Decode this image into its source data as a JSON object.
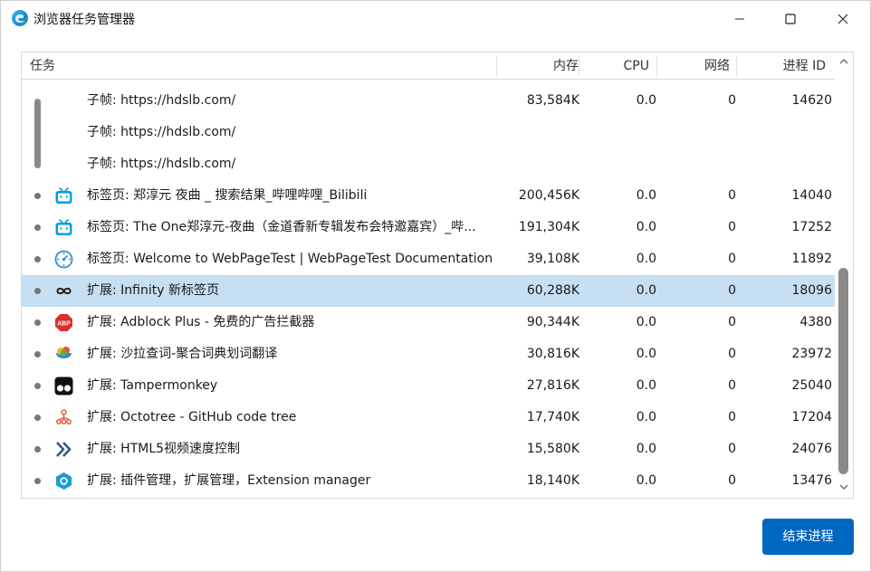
{
  "window": {
    "title": "浏览器任务管理器",
    "icons": {
      "app": "edge-logo-icon",
      "minimize": "minimize-icon",
      "maximize": "maximize-icon",
      "close": "close-icon"
    }
  },
  "columns": {
    "task": "任务",
    "memory": "内存",
    "cpu": "CPU",
    "network": "网络",
    "pid": "进程 ID"
  },
  "rows": [
    {
      "name": "子帧: https://hdslb.com/",
      "memory": "83,584K",
      "cpu": "0.0",
      "network": "0",
      "pid": "14620",
      "icon": "",
      "bullet": false,
      "selected": false
    },
    {
      "name": "子帧: https://hdslb.com/",
      "memory": "",
      "cpu": "",
      "network": "",
      "pid": "",
      "icon": "",
      "bullet": false,
      "selected": false
    },
    {
      "name": "子帧: https://hdslb.com/",
      "memory": "",
      "cpu": "",
      "network": "",
      "pid": "",
      "icon": "",
      "bullet": false,
      "selected": false
    },
    {
      "name": "标签页: 郑淳元 夜曲 _ 搜索结果_哔哩哔哩_Bilibili",
      "memory": "200,456K",
      "cpu": "0.0",
      "network": "0",
      "pid": "14040",
      "icon": "bilibili-icon",
      "bullet": true,
      "selected": false
    },
    {
      "name": "标签页: The One郑淳元-夜曲（金道香新专辑发布会特邀嘉宾）_哔...",
      "memory": "191,304K",
      "cpu": "0.0",
      "network": "0",
      "pid": "17252",
      "icon": "bilibili-icon",
      "bullet": true,
      "selected": false
    },
    {
      "name": "标签页: Welcome to WebPageTest | WebPageTest Documentation",
      "memory": "39,108K",
      "cpu": "0.0",
      "network": "0",
      "pid": "11892",
      "icon": "webpagetest-icon",
      "bullet": true,
      "selected": false
    },
    {
      "name": "扩展: Infinity 新标签页",
      "memory": "60,288K",
      "cpu": "0.0",
      "network": "0",
      "pid": "18096",
      "icon": "infinity-icon",
      "bullet": true,
      "selected": true
    },
    {
      "name": "扩展: Adblock Plus - 免费的广告拦截器",
      "memory": "90,344K",
      "cpu": "0.0",
      "network": "0",
      "pid": "4380",
      "icon": "adblock-plus-icon",
      "bullet": true,
      "selected": false
    },
    {
      "name": "扩展: 沙拉查词-聚合词典划词翻译",
      "memory": "30,816K",
      "cpu": "0.0",
      "network": "0",
      "pid": "23972",
      "icon": "saladict-icon",
      "bullet": true,
      "selected": false
    },
    {
      "name": "扩展: Tampermonkey",
      "memory": "27,816K",
      "cpu": "0.0",
      "network": "0",
      "pid": "25040",
      "icon": "tampermonkey-icon",
      "bullet": true,
      "selected": false
    },
    {
      "name": "扩展: Octotree - GitHub code tree",
      "memory": "17,740K",
      "cpu": "0.0",
      "network": "0",
      "pid": "17204",
      "icon": "octotree-icon",
      "bullet": true,
      "selected": false
    },
    {
      "name": "扩展: HTML5视频速度控制",
      "memory": "15,580K",
      "cpu": "0.0",
      "network": "0",
      "pid": "24076",
      "icon": "chevron-double-right-icon",
      "bullet": true,
      "selected": false
    },
    {
      "name": "扩展: 插件管理，扩展管理，Extension manager",
      "memory": "18,140K",
      "cpu": "0.0",
      "network": "0",
      "pid": "13476",
      "icon": "extension-manager-icon",
      "bullet": true,
      "selected": false
    }
  ],
  "buttons": {
    "end_process": "结束进程"
  },
  "colors": {
    "accent": "#0067c0",
    "selection": "#c6dff3",
    "bilibili": "#00a1d6",
    "adblock": "#d9302c"
  }
}
